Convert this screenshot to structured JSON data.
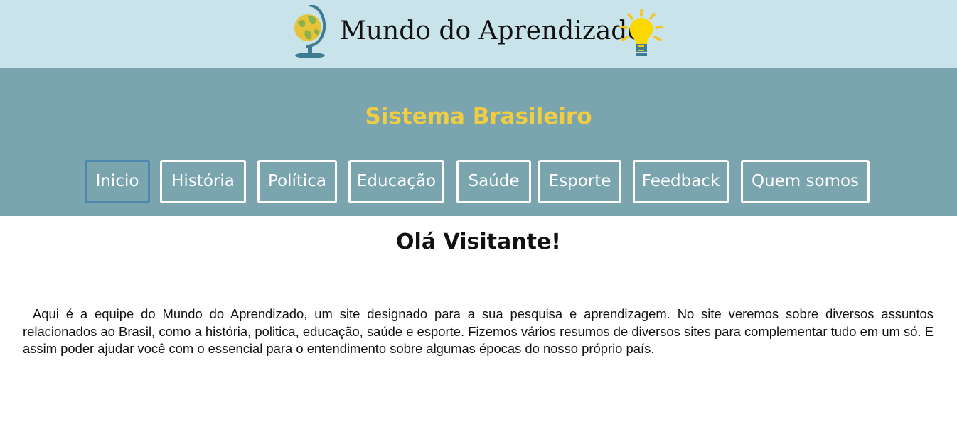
{
  "header": {
    "site_title": "Mundo do Aprendizado",
    "logo_icon": "globe-icon",
    "idea_icon": "lightbulb-icon"
  },
  "nav": {
    "section_title": "Sistema Brasileiro",
    "active_item": "Inicio",
    "items": [
      {
        "label": "Inicio"
      },
      {
        "label": "História"
      },
      {
        "label": "Política"
      },
      {
        "label": "Educação"
      },
      {
        "label": "Saúde"
      },
      {
        "label": "Esporte"
      },
      {
        "label": "Feedback"
      },
      {
        "label": "Quem somos"
      }
    ]
  },
  "main": {
    "greeting": "Olá Visitante!",
    "intro": "Aqui é a equipe do Mundo do Aprendizado, um site designado para a sua pesquisa e aprendizagem. No site veremos sobre diversos assuntos relacionados ao Brasil, como a história, politica, educação, saúde e esporte. Fizemos vários resumos de diversos sites para complementar tudo em um só. E assim poder ajudar você com o essencial para o entendimento sobre algumas épocas do nosso próprio país."
  },
  "colors": {
    "banner_bg": "#c9e3ea",
    "nav_bg": "#7ba5ae",
    "section_title": "#f1cd43",
    "active_border": "#4c88ad"
  }
}
